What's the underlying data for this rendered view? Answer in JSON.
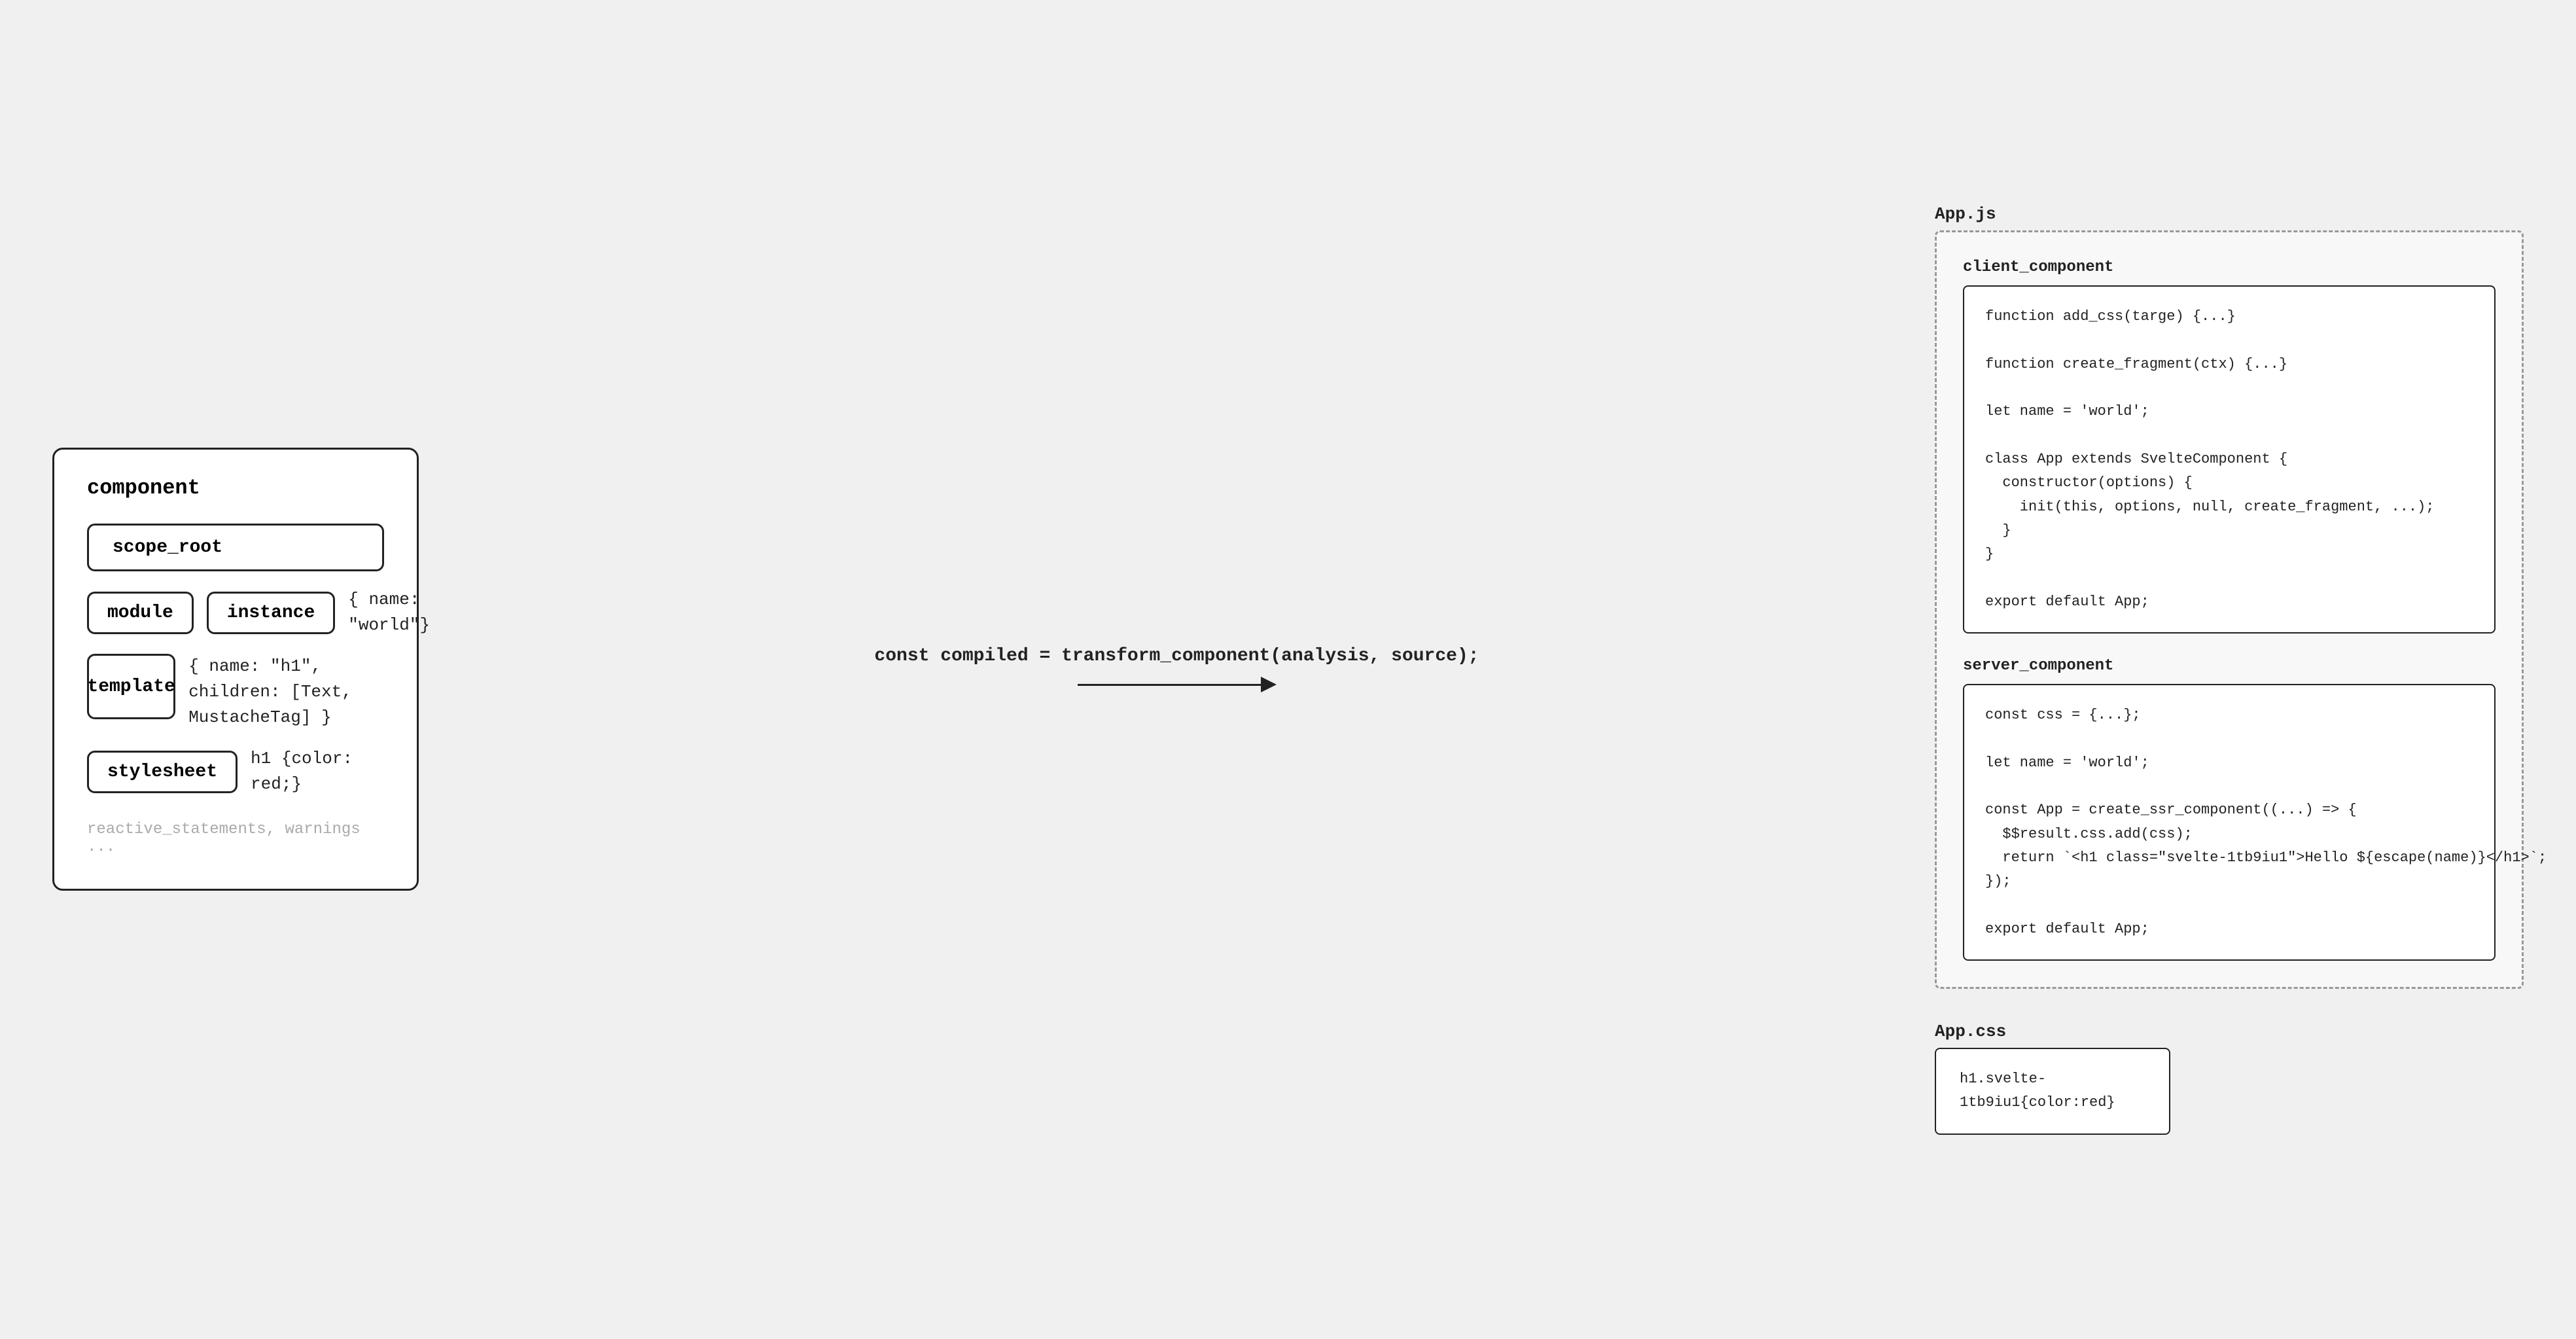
{
  "component": {
    "label": "component",
    "scope_root": "scope_root",
    "module": "module",
    "instance": "instance",
    "instance_data": "{ name: \"world\"}",
    "template": "template",
    "template_data": "{\n  name: \"h1\",\n  children: [Text, MustacheTag]\n}",
    "stylesheet": "stylesheet",
    "stylesheet_data": "h1 {color: red;}",
    "reactive": "reactive_statements, warnings ..."
  },
  "arrow": {
    "label": "const compiled = transform_component(analysis, source);"
  },
  "appjs": {
    "file_label": "App.js",
    "client_label": "client_component",
    "client_code": "function add_css(targe) {...}\n\nfunction create_fragment(ctx) {...}\n\nlet name = 'world';\n\nclass App extends SvelteComponent {\n  constructor(options) {\n    init(this, options, null, create_fragment, ...);\n  }\n}\n\nexport default App;",
    "server_label": "server_component",
    "server_code": "const css = {...};\n\nlet name = 'world';\n\nconst App = create_ssr_component((...) => {\n  $$result.css.add(css);\n  return `<h1 class=\"svelte-1tb9iu1\">Hello ${escape(name)}</h1>`;\n});\n\nexport default App;"
  },
  "appcss": {
    "file_label": "App.css",
    "code": "h1.svelte-\n1tb9iu1{color:red}"
  }
}
